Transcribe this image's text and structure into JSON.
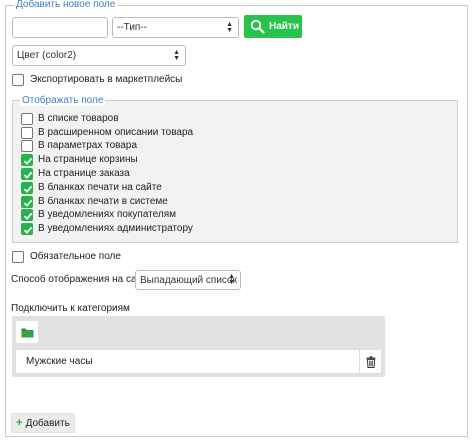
{
  "outer_fieldset": {
    "legend": "Добавить новое поле"
  },
  "search": {
    "input_value": "",
    "type_select": "--Тип--",
    "find_button": "Найти"
  },
  "color_select": "Цвет (color2)",
  "export": {
    "label": "Экспортировать в маркетплейсы",
    "checked": false
  },
  "display_group": {
    "legend": "Отображать поле",
    "items": [
      {
        "label": "В списке товаров",
        "checked": false
      },
      {
        "label": "В расширенном описании товара",
        "checked": false
      },
      {
        "label": "В параметрах товара",
        "checked": false
      },
      {
        "label": "На странице корзины",
        "checked": true
      },
      {
        "label": "На странице заказа",
        "checked": true
      },
      {
        "label": "В бланках печати на сайте",
        "checked": true
      },
      {
        "label": "В бланках печати в системе",
        "checked": true
      },
      {
        "label": "В уведомлениях покупателям",
        "checked": true
      },
      {
        "label": "В уведомлениях администратору",
        "checked": true
      }
    ]
  },
  "required": {
    "label": "Обязательное поле",
    "checked": false
  },
  "display_mode": {
    "label": "Способ отображения на сайте",
    "value": "Выпадающий список"
  },
  "categories": {
    "label": "Подключить к категориям",
    "items": [
      "Мужские часы"
    ]
  },
  "add_button": "Добавить",
  "colors": {
    "accent": "#27c34b",
    "legend": "#3c7fc7",
    "check": "#26b34a"
  },
  "icons": [
    "search-icon",
    "folder-icon",
    "trash-icon",
    "plus-icon",
    "chevron-updown-icon",
    "checkmark-icon"
  ]
}
